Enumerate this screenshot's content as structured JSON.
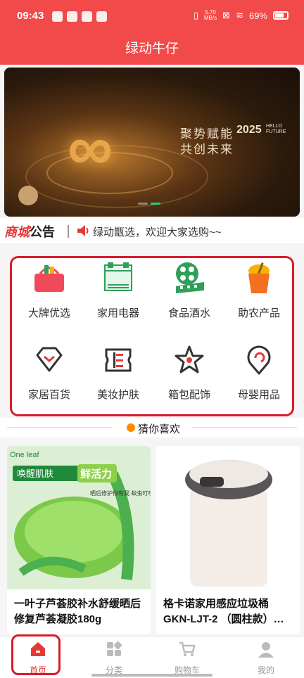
{
  "status_bar": {
    "time": "09:43",
    "net_speed": "5.70",
    "net_unit": "MB/s",
    "battery": "69%"
  },
  "app": {
    "title": "绿动牛仔"
  },
  "banner": {
    "slogan_line1": "聚势赋能",
    "slogan_line2": "共创未来",
    "year": "2025",
    "tagline": "HELLO FUTURE"
  },
  "notice": {
    "tag_red": "商城",
    "tag_dark": "公告",
    "text": "绿动甑选，欢迎大家选购~~"
  },
  "categories": [
    {
      "label": "大牌优选",
      "icon": "basket-icon"
    },
    {
      "label": "家用电器",
      "icon": "bed-icon"
    },
    {
      "label": "食品酒水",
      "icon": "film-reel-icon"
    },
    {
      "label": "助农产品",
      "icon": "noodle-cup-icon"
    },
    {
      "label": "家居百货",
      "icon": "diamond-icon"
    },
    {
      "label": "美妆护肤",
      "icon": "ticket-icon"
    },
    {
      "label": "箱包配饰",
      "icon": "star-icon"
    },
    {
      "label": "母婴用品",
      "icon": "location-pin-icon"
    }
  ],
  "recommend": {
    "title": "猜你喜欢"
  },
  "products": [
    {
      "name": "一叶子芦荟胶补水舒缓晒后修复芦荟凝胶180g",
      "brand": "One leaf",
      "badge1": "唤醒肌肤",
      "badge2": "鲜活力",
      "desc": "晒后修护你有我 蚊虫叮咬体一抹"
    },
    {
      "name": "格卡诺家用感应垃圾桶GKN-LJT-2 （圆柱款）…"
    }
  ],
  "tabbar": [
    {
      "label": "首页",
      "icon": "home-icon",
      "active": true
    },
    {
      "label": "分类",
      "icon": "category-icon",
      "active": false
    },
    {
      "label": "购物车",
      "icon": "cart-icon",
      "active": false
    },
    {
      "label": "我的",
      "icon": "user-icon",
      "active": false
    }
  ]
}
